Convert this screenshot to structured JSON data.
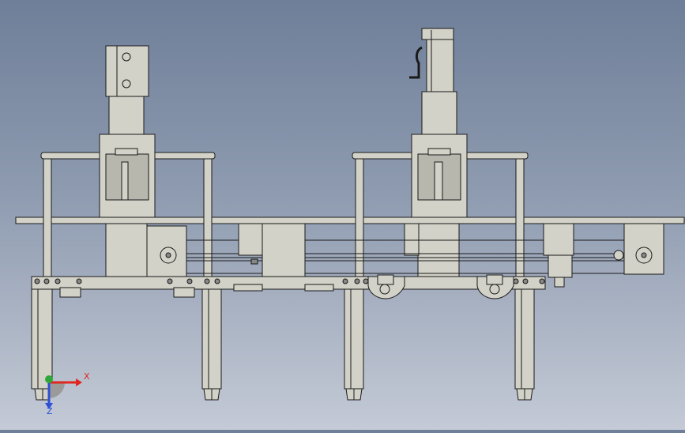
{
  "viewport": {
    "background_top": "#6f7f99",
    "background_bottom": "#c4cad6",
    "part_fill": "#d3d2c8",
    "part_stroke": "#1a1a1a"
  },
  "triad": {
    "x_label": "X",
    "z_label": "Z",
    "x_color": "#e0261f",
    "y_color": "#2ea83a",
    "z_color": "#2c4fd6"
  }
}
